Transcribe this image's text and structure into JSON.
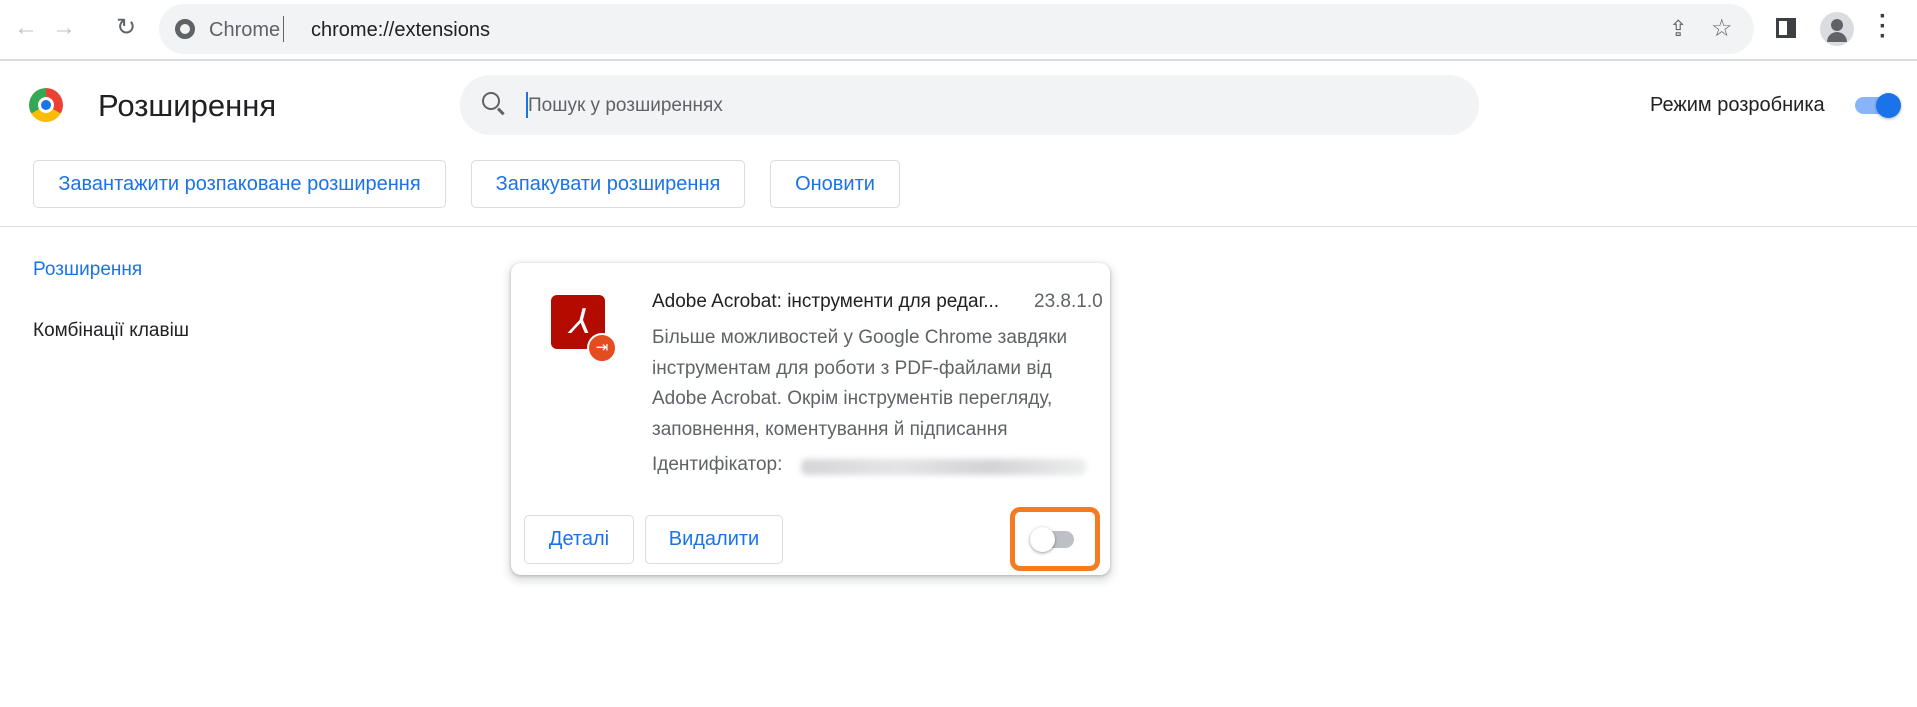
{
  "browser": {
    "site_label": "Chrome",
    "url": "chrome://extensions"
  },
  "header": {
    "title": "Розширення",
    "search_placeholder": "Пошук у розширеннях",
    "dev_mode_label": "Режим розробника",
    "dev_mode_on": true
  },
  "actions": {
    "load_unpacked": "Завантажити розпаковане розширення",
    "pack": "Запакувати розширення",
    "update": "Оновити"
  },
  "sidebar": {
    "items": [
      {
        "label": "Розширення",
        "active": true
      },
      {
        "label": "Комбінації клавіш",
        "active": false
      }
    ]
  },
  "extension": {
    "name": "Adobe Acrobat: інструменти для редаг...",
    "version": "23.8.1.0",
    "description": "Більше можливостей у Google Chrome завдяки інструментам для роботи з PDF-файлами від Adobe Acrobat. Окрім інструментів перегляду, заповнення, коментування й підписання",
    "id_label": "Ідентифікатор:",
    "details_label": "Деталі",
    "remove_label": "Видалити",
    "enabled": false
  },
  "colors": {
    "accent": "#1a73e8",
    "highlight": "#f47b20",
    "acrobat_red": "#b30b00"
  }
}
